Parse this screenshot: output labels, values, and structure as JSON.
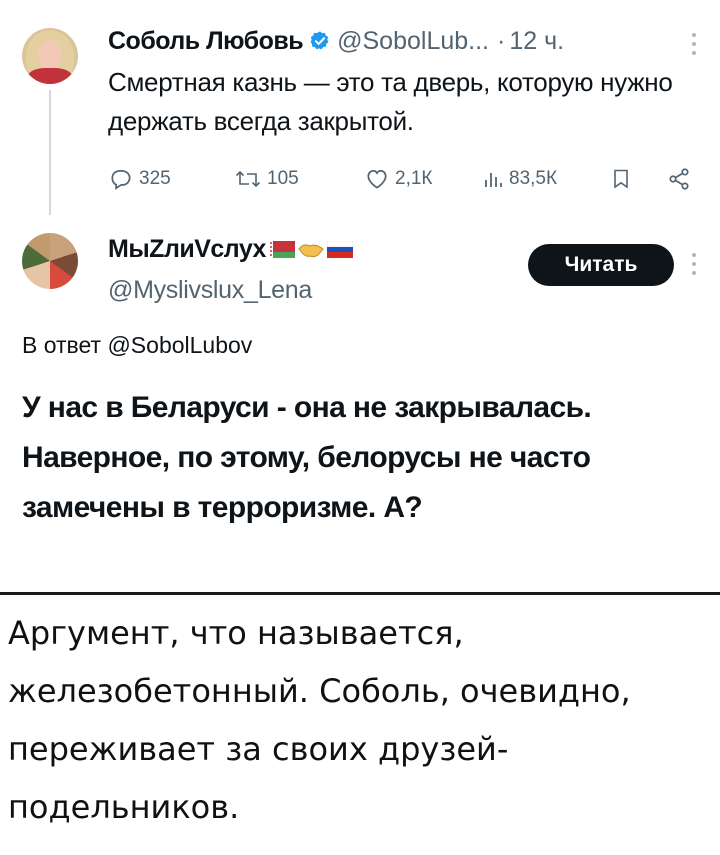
{
  "tweet1": {
    "author_name": "Соболь Любовь",
    "handle": "@SobolLub...",
    "separator": "·",
    "time": "12 ч.",
    "text": "Смертная казнь — это та дверь, которую нужно держать всегда закрытой.",
    "replies": "325",
    "reposts": "105",
    "likes": "2,1К",
    "views": "83,5К"
  },
  "tweet2": {
    "author_name": "МыZлиVслух",
    "handle": "@Myslivslux_Lena",
    "read_button": "Читать",
    "reply_to": "В ответ @SobolLubov",
    "text": "У нас в Беларуси - она не закрывалась. Наверное, по этому, белорусы не часто замечены в терроризме. А?"
  },
  "comment": {
    "text": "Аргумент, что называется, железобетонный. Соболь, очевидно, переживает за своих друзей- подельников."
  },
  "colors": {
    "verified": "#1d9bf0",
    "muted": "#536471",
    "button_bg": "#0f1419"
  },
  "icons": [
    "verified-badge-icon",
    "more-icon",
    "reply-icon",
    "repost-icon",
    "like-icon",
    "views-icon",
    "bookmark-icon",
    "share-icon",
    "handshake-emoji-icon",
    "belarus-flag-icon",
    "russia-flag-icon"
  ]
}
